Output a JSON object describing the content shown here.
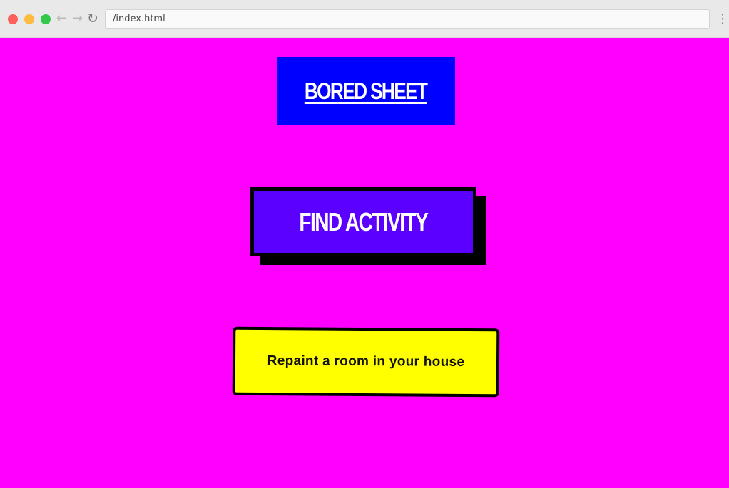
{
  "browser": {
    "url": "/index.html",
    "icons": {
      "back": "arrow-left-icon",
      "forward": "arrow-right-icon",
      "reload": "reload-icon",
      "menu": "more-vertical-icon"
    }
  },
  "page": {
    "title": "BORED SHEET",
    "find_button_label": "FIND ACTIVITY",
    "activity": "Repaint a room in your house"
  },
  "colors": {
    "background": "#ff00ff",
    "title_box": "#0000ff",
    "find_button": "#5b00ff",
    "activity_card": "#ffff00"
  }
}
